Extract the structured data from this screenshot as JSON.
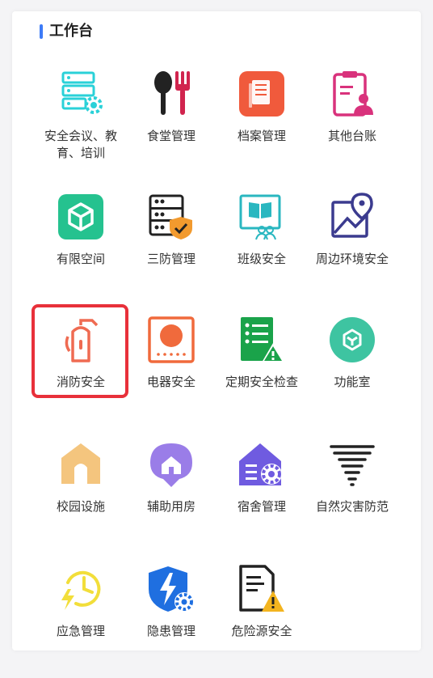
{
  "header": {
    "title": "工作台"
  },
  "items": [
    {
      "label": "安全会议、教育、培训",
      "icon": "server-settings-icon"
    },
    {
      "label": "食堂管理",
      "icon": "spoon-fork-icon"
    },
    {
      "label": "档案管理",
      "icon": "document-icon"
    },
    {
      "label": "其他台账",
      "icon": "clipboard-user-icon"
    },
    {
      "label": "有限空间",
      "icon": "cube-icon"
    },
    {
      "label": "三防管理",
      "icon": "server-shield-icon"
    },
    {
      "label": "班级安全",
      "icon": "book-people-icon"
    },
    {
      "label": "周边环境安全",
      "icon": "map-pin-icon"
    },
    {
      "label": "消防安全",
      "icon": "fire-extinguisher-icon"
    },
    {
      "label": "电器安全",
      "icon": "stove-icon"
    },
    {
      "label": "定期安全检查",
      "icon": "checklist-warning-icon"
    },
    {
      "label": "功能室",
      "icon": "room-cube-icon"
    },
    {
      "label": "校园设施",
      "icon": "house-gate-icon"
    },
    {
      "label": "辅助用房",
      "icon": "house-pin-icon"
    },
    {
      "label": "宿舍管理",
      "icon": "house-gear-icon"
    },
    {
      "label": "自然灾害防范",
      "icon": "tornado-icon"
    },
    {
      "label": "应急管理",
      "icon": "clock-lightning-icon"
    },
    {
      "label": "隐患管理",
      "icon": "shield-lightning-gear-icon"
    },
    {
      "label": "危险源安全",
      "icon": "document-warning-icon"
    }
  ],
  "selected_item": "消防安全",
  "colors": {
    "accent": "#3d7bf7",
    "selection": "#e8303a"
  }
}
